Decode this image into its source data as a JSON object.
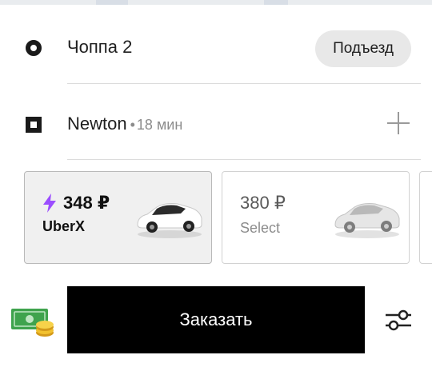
{
  "route": {
    "pickup": "Чоппа 2",
    "entrance_label": "Подъезд",
    "destination": "Newton",
    "eta_separator": "•",
    "eta": "18 мин"
  },
  "rides": [
    {
      "price": "348 ₽",
      "tier": "UberX",
      "selected": true,
      "surge": true
    },
    {
      "price": "380 ₽",
      "tier": "Select",
      "selected": false,
      "surge": false
    }
  ],
  "order_button_label": "Заказать",
  "colors": {
    "surge_bolt": "#9b4dff",
    "order_button": "#000000"
  },
  "icons": [
    "pickup-pin-icon",
    "destination-pin-icon",
    "add-stop-icon",
    "surge-bolt-icon",
    "car-icon",
    "payment-cash-icon",
    "filter-icon"
  ]
}
